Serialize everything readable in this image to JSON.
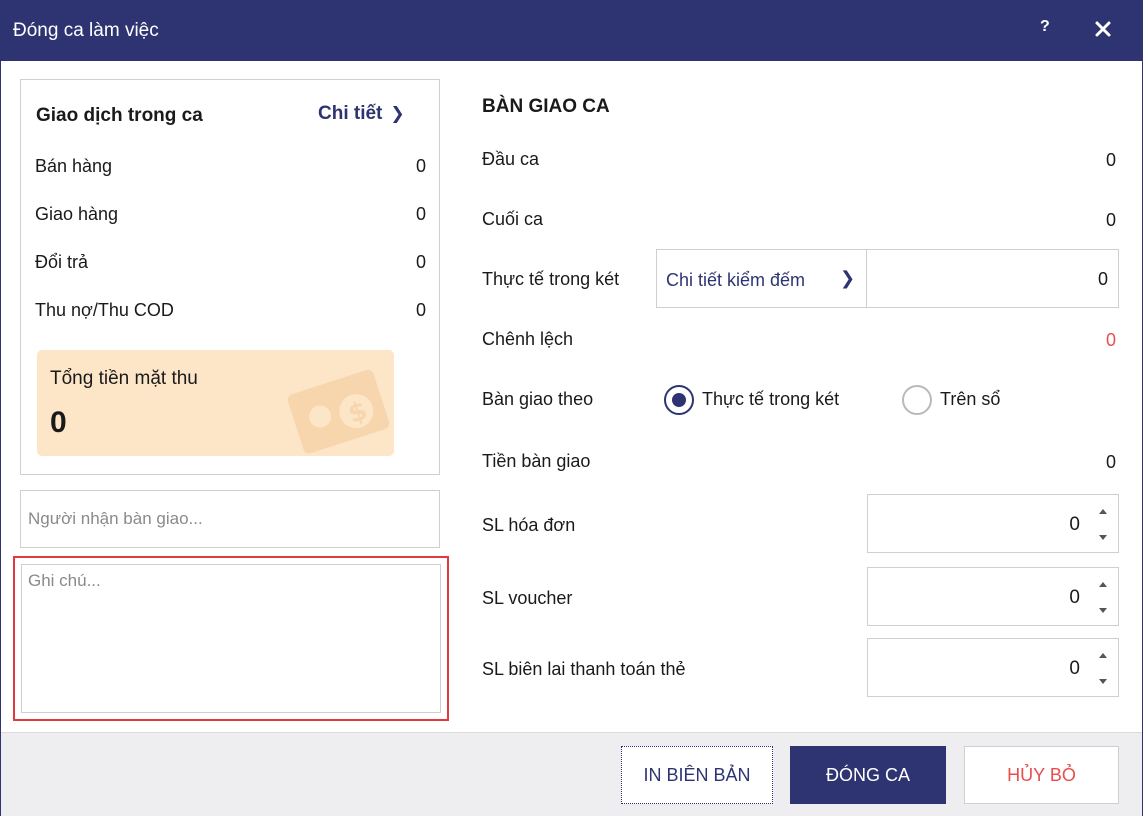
{
  "window": {
    "title": "Đóng ca làm việc",
    "help_label": "?"
  },
  "transactions": {
    "title": "Giao dịch trong ca",
    "detail_link": "Chi tiết",
    "rows": [
      {
        "label": "Bán hàng",
        "value": "0"
      },
      {
        "label": "Giao hàng",
        "value": "0"
      },
      {
        "label": "Đổi trả",
        "value": "0"
      },
      {
        "label": "Thu nợ/Thu COD",
        "value": "0"
      }
    ],
    "cash_total_label": "Tổng tiền mặt thu",
    "cash_total_value": "0"
  },
  "receiver": {
    "placeholder": "Người nhận bàn giao..."
  },
  "note": {
    "placeholder": "Ghi chú..."
  },
  "handover": {
    "title": "BÀN GIAO CA",
    "start_label": "Đầu ca",
    "start_value": "0",
    "end_label": "Cuối ca",
    "end_value": "0",
    "actual_label": "Thực tế trong két",
    "count_detail_link": "Chi tiết kiểm đếm",
    "actual_value": "0",
    "diff_label": "Chênh lệch",
    "diff_value": "0",
    "handover_by_label": "Bàn giao theo",
    "options": [
      {
        "label": "Thực tế trong két",
        "selected": true
      },
      {
        "label": "Trên sổ",
        "selected": false
      }
    ],
    "handover_amount_label": "Tiền bàn giao",
    "handover_amount_value": "0",
    "invoice_count_label": "SL hóa đơn",
    "invoice_count_value": "0",
    "voucher_count_label": "SL voucher",
    "voucher_count_value": "0",
    "card_receipt_count_label": "SL biên lai thanh toán thẻ",
    "card_receipt_count_value": "0"
  },
  "footer": {
    "print_label": "IN BIÊN BẢN",
    "close_shift_label": "ĐÓNG CA",
    "cancel_label": "HỦY BỎ"
  },
  "colors": {
    "primary": "#2e3472",
    "danger": "#e94e4e",
    "cash_card": "#fde6c8",
    "highlight_border": "#e0393e"
  }
}
